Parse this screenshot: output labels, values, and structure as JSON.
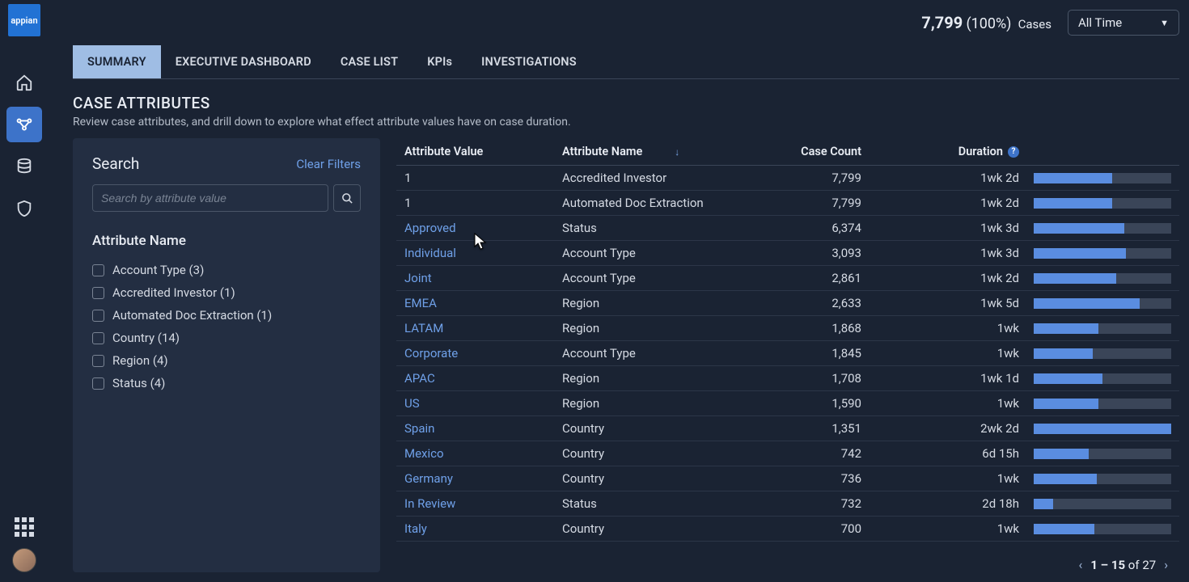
{
  "brand": "appian",
  "topbar": {
    "count": "7,799",
    "pct": "(100%)",
    "label": "Cases",
    "time_filter": "All Time"
  },
  "tabs": [
    "SUMMARY",
    "EXECUTIVE DASHBOARD",
    "CASE LIST",
    "KPIs",
    "INVESTIGATIONS"
  ],
  "section": {
    "title": "CASE ATTRIBUTES",
    "subtitle": "Review case attributes, and drill down to explore what effect attribute values have on case duration."
  },
  "filter": {
    "search_label": "Search",
    "clear_label": "Clear Filters",
    "search_placeholder": "Search by attribute value",
    "group_title": "Attribute Name",
    "options": [
      "Account Type (3)",
      "Accredited Investor (1)",
      "Automated Doc Extraction (1)",
      "Country (14)",
      "Region (4)",
      "Status (4)"
    ]
  },
  "table": {
    "headers": {
      "value": "Attribute Value",
      "name": "Attribute Name",
      "count": "Case Count",
      "duration": "Duration"
    },
    "rows": [
      {
        "value": "1",
        "name": "Accredited Investor",
        "count": "7,799",
        "duration": "1wk 2d",
        "bar": 57
      },
      {
        "value": "1",
        "name": "Automated Doc Extraction",
        "count": "7,799",
        "duration": "1wk 2d",
        "bar": 57
      },
      {
        "value": "Approved",
        "name": "Status",
        "count": "6,374",
        "duration": "1wk 3d",
        "bar": 66
      },
      {
        "value": "Individual",
        "name": "Account Type",
        "count": "3,093",
        "duration": "1wk 3d",
        "bar": 67
      },
      {
        "value": "Joint",
        "name": "Account Type",
        "count": "2,861",
        "duration": "1wk 2d",
        "bar": 60
      },
      {
        "value": "EMEA",
        "name": "Region",
        "count": "2,633",
        "duration": "1wk 5d",
        "bar": 77
      },
      {
        "value": "LATAM",
        "name": "Region",
        "count": "1,868",
        "duration": "1wk",
        "bar": 47
      },
      {
        "value": "Corporate",
        "name": "Account Type",
        "count": "1,845",
        "duration": "1wk",
        "bar": 43
      },
      {
        "value": "APAC",
        "name": "Region",
        "count": "1,708",
        "duration": "1wk 1d",
        "bar": 50
      },
      {
        "value": "US",
        "name": "Region",
        "count": "1,590",
        "duration": "1wk",
        "bar": 47
      },
      {
        "value": "Spain",
        "name": "Country",
        "count": "1,351",
        "duration": "2wk 2d",
        "bar": 100
      },
      {
        "value": "Mexico",
        "name": "Country",
        "count": "742",
        "duration": "6d 15h",
        "bar": 40
      },
      {
        "value": "Germany",
        "name": "Country",
        "count": "736",
        "duration": "1wk",
        "bar": 46
      },
      {
        "value": "In Review",
        "name": "Status",
        "count": "732",
        "duration": "2d 18h",
        "bar": 14
      },
      {
        "value": "Italy",
        "name": "Country",
        "count": "700",
        "duration": "1wk",
        "bar": 44
      }
    ],
    "pagination": {
      "range": "1 – 15",
      "of_label": "of",
      "total": "27"
    }
  }
}
